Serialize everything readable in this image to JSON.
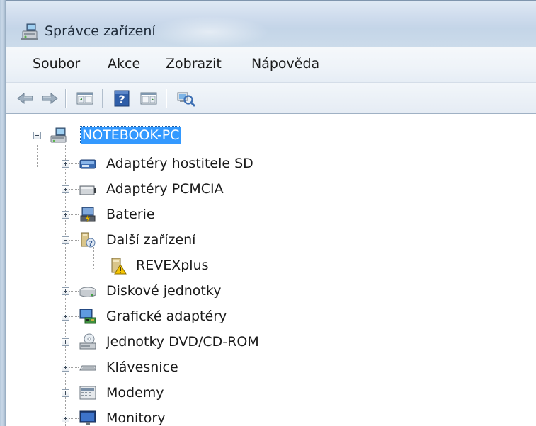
{
  "window": {
    "title": "Správce zařízení"
  },
  "menu": {
    "items": [
      "Soubor",
      "Akce",
      "Zobrazit",
      "Nápověda"
    ]
  },
  "toolbar": {
    "buttons": [
      {
        "icon": "back-arrow-icon"
      },
      {
        "icon": "forward-arrow-icon"
      },
      {
        "icon": "show-hide-console-tree-icon"
      },
      {
        "icon": "help-icon"
      },
      {
        "icon": "show-action-pane-icon"
      },
      {
        "icon": "scan-hardware-changes-icon"
      }
    ]
  },
  "tree": {
    "root": {
      "label": "NOTEBOOK-PC",
      "icon": "computer-icon",
      "expanded": true,
      "selected": true
    },
    "items": [
      {
        "label": "Adaptéry hostitele SD",
        "icon": "sd-host-adapter-icon",
        "expanded": false
      },
      {
        "label": "Adaptéry PCMCIA",
        "icon": "pcmcia-adapter-icon",
        "expanded": false
      },
      {
        "label": "Baterie",
        "icon": "battery-icon",
        "expanded": false
      },
      {
        "label": "Další zařízení",
        "icon": "other-devices-icon",
        "expanded": true
      },
      {
        "label": "REVEXplus",
        "icon": "unknown-device-warning-icon",
        "child": true
      },
      {
        "label": "Diskové jednotky",
        "icon": "disk-drive-icon",
        "expanded": false
      },
      {
        "label": "Grafické adaptéry",
        "icon": "display-adapter-icon",
        "expanded": false
      },
      {
        "label": "Jednotky DVD/CD-ROM",
        "icon": "dvd-drive-icon",
        "expanded": false
      },
      {
        "label": "Klávesnice",
        "icon": "keyboard-icon",
        "expanded": false
      },
      {
        "label": "Modemy",
        "icon": "modem-icon",
        "expanded": false
      },
      {
        "label": "Monitory",
        "icon": "monitor-icon",
        "expanded": false
      }
    ]
  },
  "colors": {
    "selection": "#3399ff",
    "warning": "#f5c400"
  }
}
